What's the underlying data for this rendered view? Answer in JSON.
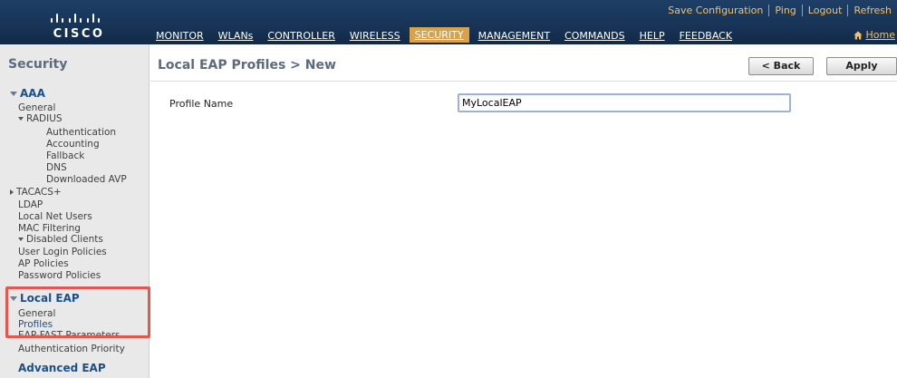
{
  "header": {
    "brand": "CISCO",
    "toplinks": {
      "save_configuration": "Save Configuration",
      "ping": "Ping",
      "logout": "Logout",
      "refresh": "Refresh"
    },
    "nav": [
      {
        "label": "MONITOR"
      },
      {
        "label": "WLANs"
      },
      {
        "label": "CONTROLLER"
      },
      {
        "label": "WIRELESS"
      },
      {
        "label": "SECURITY",
        "active": true
      },
      {
        "label": "MANAGEMENT"
      },
      {
        "label": "COMMANDS"
      },
      {
        "label": "HELP"
      },
      {
        "label": "FEEDBACK"
      }
    ],
    "home": "Home",
    "home_icon": "house-icon"
  },
  "sidebar": {
    "title": "Security",
    "aaa": "AAA",
    "general": "General",
    "radius": "RADIUS",
    "authentication": "Authentication",
    "accounting": "Accounting",
    "fallback": "Fallback",
    "dns": "DNS",
    "downloaded_avp": "Downloaded AVP",
    "tacacs": "TACACS+",
    "ldap": "LDAP",
    "local_net_users": "Local Net Users",
    "mac_filtering": "MAC Filtering",
    "disabled_clients": "Disabled Clients",
    "user_login_policies": "User Login Policies",
    "ap_policies": "AP Policies",
    "password_policies": "Password Policies",
    "local_eap": "Local EAP",
    "local_eap_general": "General",
    "profiles": "Profiles",
    "eap_fast_parameters": "EAP-FAST Parameters",
    "authentication_priority": "Authentication Priority",
    "advanced_eap": "Advanced EAP"
  },
  "main": {
    "title": "Local EAP Profiles > New",
    "back_label": "< Back",
    "apply_label": "Apply",
    "profile_name_label": "Profile Name",
    "profile_name_value": "MyLocalEAP"
  },
  "colors": {
    "header_bg": "#173356",
    "active_tab": "#d8a24a",
    "link_gold": "#f3c16a",
    "highlight": "#e4574e",
    "sidebar_bg": "#e9e9e9"
  }
}
